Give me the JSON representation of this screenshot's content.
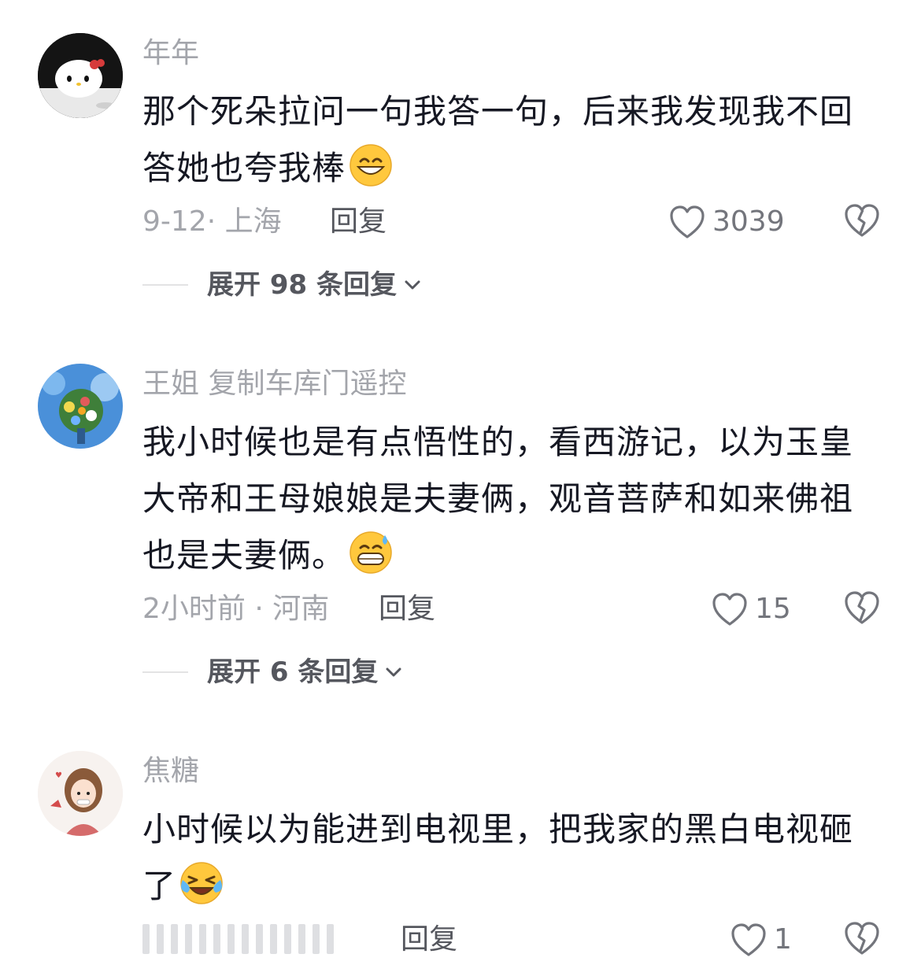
{
  "comments": [
    {
      "username": "年年",
      "content": "那个死朵拉问一句我答一句，后来我发现我不回答她也夸我棒",
      "meta": "9-12· 上海",
      "reply_label": "回复",
      "likes": "3039",
      "expand_label": "展开 98 条回复",
      "emoji": "grin-emoji"
    },
    {
      "username": "王姐 复制车库门遥控",
      "content": "我小时候也是有点悟性的，看西游记，以为玉皇大帝和王母娘娘是夫妻俩，观音菩萨和如来佛祖也是夫妻俩。",
      "meta": "2小时前 · 河南",
      "reply_label": "回复",
      "likes": "15",
      "expand_label": "展开 6 条回复",
      "emoji": "sweat-grin-emoji"
    },
    {
      "username": "焦糖",
      "content": "小时候以为能进到电视里，把我家的黑白电视砸了",
      "meta": "",
      "reply_label": "回复",
      "likes": "1",
      "emoji": "laugh-cry-emoji"
    }
  ],
  "colors": {
    "text_primary": "#161823",
    "text_secondary": "#a3a5ab",
    "emoji_yellow": "#ffc83d"
  },
  "icons": {
    "like": "heart-outline-icon",
    "dislike": "broken-heart-icon",
    "expand": "chevron-down-icon"
  }
}
